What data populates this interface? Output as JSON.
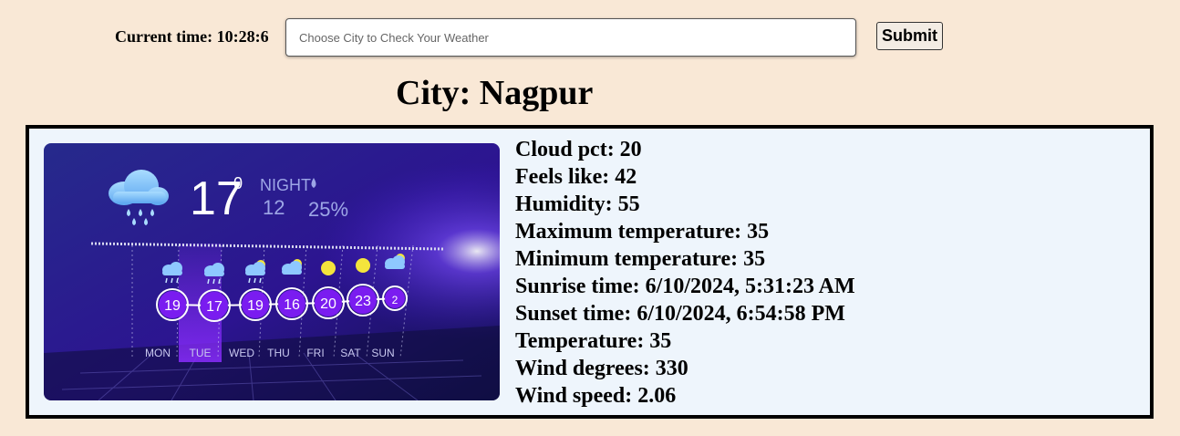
{
  "header": {
    "time_label": "Current time: 10:28:6",
    "search_placeholder": "Choose City to Check Your Weather",
    "submit_label": "Submit"
  },
  "city_heading": "City: Nagpur",
  "weather_image": {
    "current_temp": "17",
    "degree_symbol": "0",
    "night_label": "NIGHT",
    "night_temp": "12",
    "humidity_label": "25%",
    "forecast": [
      {
        "day": "MON",
        "temp": "19",
        "icon": "rain-cloud-icon"
      },
      {
        "day": "TUE",
        "temp": "17",
        "icon": "rain-cloud-icon"
      },
      {
        "day": "WED",
        "temp": "19",
        "icon": "rain-sun-cloud-icon"
      },
      {
        "day": "THU",
        "temp": "16",
        "icon": "sun-cloud-icon"
      },
      {
        "day": "FRI",
        "temp": "20",
        "icon": "sun-icon"
      },
      {
        "day": "SAT",
        "temp": "23",
        "icon": "sun-icon"
      },
      {
        "day": "SUN",
        "temp": "2",
        "icon": "sun-cloud-icon"
      }
    ]
  },
  "details": [
    "Cloud pct: 20",
    "Feels like: 42",
    "Humidity: 55",
    "Maximum temperature: 35",
    "Minimum temperature: 35",
    "Sunrise time: 6/10/2024, 5:31:23 AM",
    "Sunset time: 6/10/2024, 6:54:58 PM",
    "Temperature: 35",
    "Wind degrees: 330",
    "Wind speed: 2.06"
  ],
  "colors": {
    "page_background": "#f9e8d6",
    "panel_background": "#eef5fc",
    "image_background": "#2a1686",
    "highlight_purple": "#7a1cf0"
  }
}
